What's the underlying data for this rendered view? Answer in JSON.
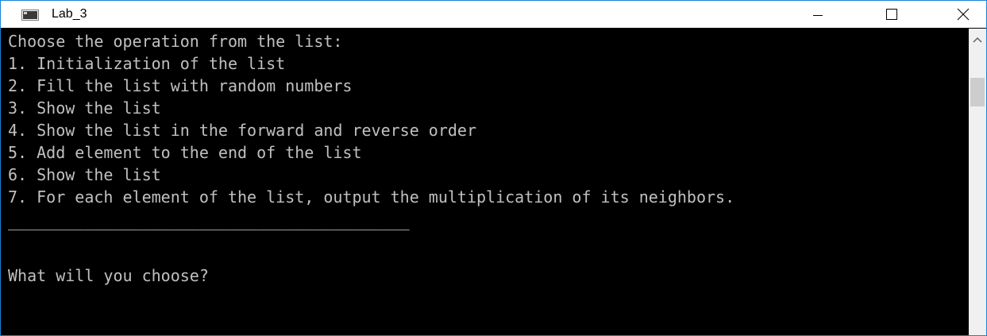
{
  "window": {
    "title": "Lab_3"
  },
  "console": {
    "lines": [
      "Choose the operation from the list:",
      "1. Initialization of the list",
      "2. Fill the list with random numbers",
      "3. Show the list",
      "4. Show the list in the forward and reverse order",
      "5. Add element to the end of the list",
      "6. Show the list",
      "7. For each element of the list, output the multiplication of its neighbors.",
      "__________________________________________",
      "What will you choose?"
    ]
  },
  "icons": {
    "app": "console-window-icon",
    "minimize": "minimize-icon",
    "maximize": "maximize-icon",
    "close": "close-icon",
    "scroll_up": "chevron-up-icon"
  },
  "colors": {
    "console_bg": "#000000",
    "console_text": "#c0c0c0",
    "window_border": "#1883d7"
  }
}
